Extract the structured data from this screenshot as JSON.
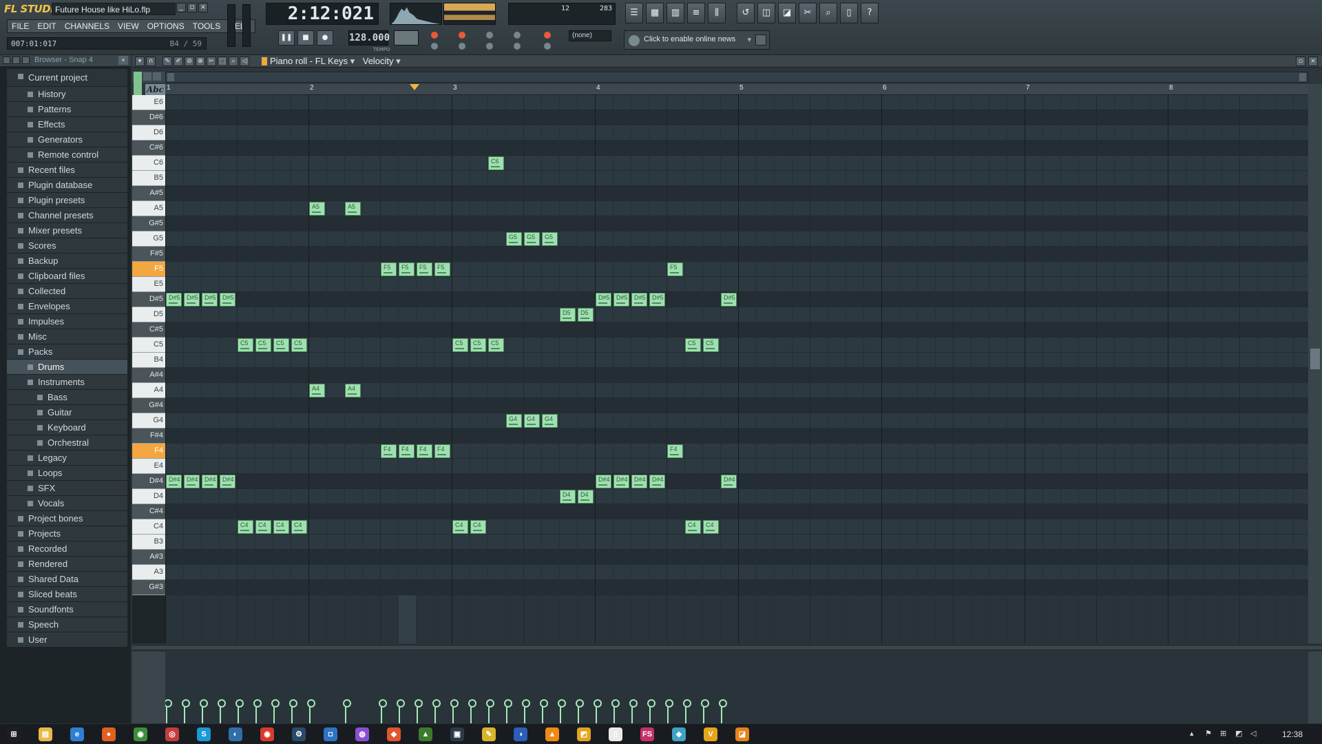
{
  "app": {
    "logo": "FL STUDIO",
    "project_title": "Future House like HiLo.flp",
    "window_buttons": [
      "_",
      "▫",
      "×"
    ]
  },
  "menu": [
    "FILE",
    "EDIT",
    "CHANNELS",
    "VIEW",
    "OPTIONS",
    "TOOLS",
    "HELP"
  ],
  "hint": {
    "left": "007:01:017",
    "right": "B4 / 59"
  },
  "time_display": "2:12:021",
  "tempo": "128.000",
  "tempo_label": "TEMPO",
  "cpu_digits": "283",
  "poly_digits": "12",
  "transport": {
    "pause": "❚❚",
    "stop": "■",
    "record": "●"
  },
  "pattern_select": "(none)",
  "news": {
    "text": "Click to enable online news",
    "arrow": "▾"
  },
  "browser": {
    "title": "Browser - Snap 4",
    "close": "×",
    "items": [
      {
        "label": "Current project",
        "level": 0,
        "top": true
      },
      {
        "label": "History",
        "level": 1
      },
      {
        "label": "Patterns",
        "level": 1
      },
      {
        "label": "Effects",
        "level": 1
      },
      {
        "label": "Generators",
        "level": 1
      },
      {
        "label": "Remote control",
        "level": 1
      },
      {
        "label": "Recent files",
        "level": 0
      },
      {
        "label": "Plugin database",
        "level": 0
      },
      {
        "label": "Plugin presets",
        "level": 0
      },
      {
        "label": "Channel presets",
        "level": 0
      },
      {
        "label": "Mixer presets",
        "level": 0
      },
      {
        "label": "Scores",
        "level": 0
      },
      {
        "label": "Backup",
        "level": 0
      },
      {
        "label": "Clipboard files",
        "level": 0
      },
      {
        "label": "Collected",
        "level": 0
      },
      {
        "label": "Envelopes",
        "level": 0
      },
      {
        "label": "Impulses",
        "level": 0
      },
      {
        "label": "Misc",
        "level": 0
      },
      {
        "label": "Packs",
        "level": 0
      },
      {
        "label": "Drums",
        "level": 1,
        "selected": true
      },
      {
        "label": "Instruments",
        "level": 1
      },
      {
        "label": "Bass",
        "level": 2
      },
      {
        "label": "Guitar",
        "level": 2
      },
      {
        "label": "Keyboard",
        "level": 2
      },
      {
        "label": "Orchestral",
        "level": 2
      },
      {
        "label": "Legacy",
        "level": 1
      },
      {
        "label": "Loops",
        "level": 1
      },
      {
        "label": "SFX",
        "level": 1
      },
      {
        "label": "Vocals",
        "level": 1
      },
      {
        "label": "Project bones",
        "level": 0
      },
      {
        "label": "Projects",
        "level": 0
      },
      {
        "label": "Recorded",
        "level": 0
      },
      {
        "label": "Rendered",
        "level": 0
      },
      {
        "label": "Shared Data",
        "level": 0
      },
      {
        "label": "Sliced beats",
        "level": 0
      },
      {
        "label": "Soundfonts",
        "level": 0
      },
      {
        "label": "Speech",
        "level": 0
      },
      {
        "label": "User",
        "level": 0
      }
    ]
  },
  "piano_roll": {
    "title": "Piano roll - FL Keys",
    "title_arrow": "▾",
    "target": "Velocity",
    "target_arrow": "▾",
    "abc": "Abc",
    "bars": [
      "1",
      "2",
      "3",
      "4",
      "5",
      "6",
      "7",
      "8"
    ],
    "keys": [
      "E6",
      "D#6",
      "D6",
      "C#6",
      "C6",
      "B5",
      "A#5",
      "A5",
      "G#5",
      "G5",
      "F#5",
      "F5",
      "E5",
      "D#5",
      "D5",
      "C#5",
      "C5",
      "B4",
      "A#4",
      "A4",
      "G#4",
      "G4",
      "F#4",
      "F4",
      "E4",
      "D#4",
      "D4",
      "C#4",
      "C4",
      "B3",
      "A#3",
      "A3",
      "G#3"
    ],
    "highlighted_keys": [
      "F5",
      "F4"
    ],
    "notes": [
      {
        "pitch": "D#5",
        "step": 0
      },
      {
        "pitch": "D#5",
        "step": 1
      },
      {
        "pitch": "D#5",
        "step": 2
      },
      {
        "pitch": "D#5",
        "step": 3
      },
      {
        "pitch": "C5",
        "step": 4
      },
      {
        "pitch": "C5",
        "step": 5
      },
      {
        "pitch": "C5",
        "step": 6
      },
      {
        "pitch": "C5",
        "step": 7
      },
      {
        "pitch": "A5",
        "step": 8
      },
      {
        "pitch": "A5",
        "step": 10
      },
      {
        "pitch": "F5",
        "step": 12
      },
      {
        "pitch": "F5",
        "step": 13
      },
      {
        "pitch": "F5",
        "step": 14
      },
      {
        "pitch": "F5",
        "step": 15
      },
      {
        "pitch": "C5",
        "step": 16
      },
      {
        "pitch": "C5",
        "step": 17
      },
      {
        "pitch": "C5",
        "step": 18
      },
      {
        "pitch": "C6",
        "step": 18
      },
      {
        "pitch": "G5",
        "step": 19
      },
      {
        "pitch": "G5",
        "step": 20
      },
      {
        "pitch": "G5",
        "step": 21
      },
      {
        "pitch": "D5",
        "step": 22
      },
      {
        "pitch": "D5",
        "step": 23
      },
      {
        "pitch": "D#5",
        "step": 24
      },
      {
        "pitch": "D#5",
        "step": 25
      },
      {
        "pitch": "D#5",
        "step": 26
      },
      {
        "pitch": "D#5",
        "step": 27
      },
      {
        "pitch": "F5",
        "step": 28
      },
      {
        "pitch": "C5",
        "step": 29
      },
      {
        "pitch": "C5",
        "step": 30
      },
      {
        "pitch": "D#5",
        "step": 31
      },
      {
        "pitch": "D#4",
        "step": 0
      },
      {
        "pitch": "D#4",
        "step": 1
      },
      {
        "pitch": "D#4",
        "step": 2
      },
      {
        "pitch": "D#4",
        "step": 3
      },
      {
        "pitch": "C4",
        "step": 4
      },
      {
        "pitch": "C4",
        "step": 5
      },
      {
        "pitch": "C4",
        "step": 6
      },
      {
        "pitch": "C4",
        "step": 7
      },
      {
        "pitch": "A4",
        "step": 8
      },
      {
        "pitch": "A4",
        "step": 10
      },
      {
        "pitch": "F4",
        "step": 12
      },
      {
        "pitch": "F4",
        "step": 13
      },
      {
        "pitch": "F4",
        "step": 14
      },
      {
        "pitch": "F4",
        "step": 15
      },
      {
        "pitch": "C4",
        "step": 16
      },
      {
        "pitch": "C4",
        "step": 17
      },
      {
        "pitch": "G4",
        "step": 19
      },
      {
        "pitch": "G4",
        "step": 20
      },
      {
        "pitch": "G4",
        "step": 21
      },
      {
        "pitch": "D4",
        "step": 22
      },
      {
        "pitch": "D4",
        "step": 23
      },
      {
        "pitch": "D#4",
        "step": 24
      },
      {
        "pitch": "D#4",
        "step": 25
      },
      {
        "pitch": "D#4",
        "step": 26
      },
      {
        "pitch": "D#4",
        "step": 27
      },
      {
        "pitch": "F4",
        "step": 28
      },
      {
        "pitch": "C4",
        "step": 29
      },
      {
        "pitch": "C4",
        "step": 30
      },
      {
        "pitch": "D#4",
        "step": 31
      }
    ],
    "velocity_steps": [
      0,
      1,
      2,
      3,
      4,
      5,
      6,
      7,
      8,
      10,
      12,
      13,
      14,
      15,
      16,
      17,
      18,
      19,
      20,
      21,
      22,
      23,
      24,
      25,
      26,
      27,
      28,
      29,
      30,
      31
    ],
    "velocity_level": 0.78
  },
  "taskbar": {
    "clock": "12:38",
    "apps": [
      {
        "name": "start",
        "glyph": "⊞",
        "color": "#1e1e1e"
      },
      {
        "name": "explorer",
        "glyph": "▤",
        "color": "#e8b84a"
      },
      {
        "name": "ie",
        "glyph": "e",
        "color": "#2d7fd2"
      },
      {
        "name": "firefox",
        "glyph": "●",
        "color": "#e0601e"
      },
      {
        "name": "chrome",
        "glyph": "◉",
        "color": "#3b8f3b"
      },
      {
        "name": "app5",
        "glyph": "◎",
        "color": "#c43c3c"
      },
      {
        "name": "skype",
        "glyph": "S",
        "color": "#1b98d6"
      },
      {
        "name": "app7",
        "glyph": "◐",
        "color": "#2f6ea8"
      },
      {
        "name": "app8",
        "glyph": "◉",
        "color": "#d83a2a"
      },
      {
        "name": "steam",
        "glyph": "⚙",
        "color": "#2a4a6a"
      },
      {
        "name": "app10",
        "glyph": "◘",
        "color": "#2f73c4"
      },
      {
        "name": "app11",
        "glyph": "◍",
        "color": "#8a4fd0"
      },
      {
        "name": "app12",
        "glyph": "◆",
        "color": "#e05530"
      },
      {
        "name": "app13",
        "glyph": "▲",
        "color": "#3d7a2e"
      },
      {
        "name": "app14",
        "glyph": "▣",
        "color": "#2b3a46"
      },
      {
        "name": "flstudio-active",
        "glyph": "✎",
        "color": "#d8b42a"
      },
      {
        "name": "app16",
        "glyph": "◑",
        "color": "#2a5fb8"
      },
      {
        "name": "vlc",
        "glyph": "▲",
        "color": "#f08a14"
      },
      {
        "name": "app18",
        "glyph": "◩",
        "color": "#e2a41c"
      },
      {
        "name": "app19",
        "glyph": "▯",
        "color": "#eaeaea"
      },
      {
        "name": "fs",
        "glyph": "FS",
        "color": "#c4306a"
      },
      {
        "name": "app21",
        "glyph": "◈",
        "color": "#3fa3c4"
      },
      {
        "name": "app22",
        "glyph": "V",
        "color": "#e6a51a"
      },
      {
        "name": "app23",
        "glyph": "◪",
        "color": "#e8821a"
      }
    ]
  },
  "colors": {
    "note": "#9fe0b0",
    "key_highlight": "#f4a640",
    "accent": "#f2b442"
  }
}
